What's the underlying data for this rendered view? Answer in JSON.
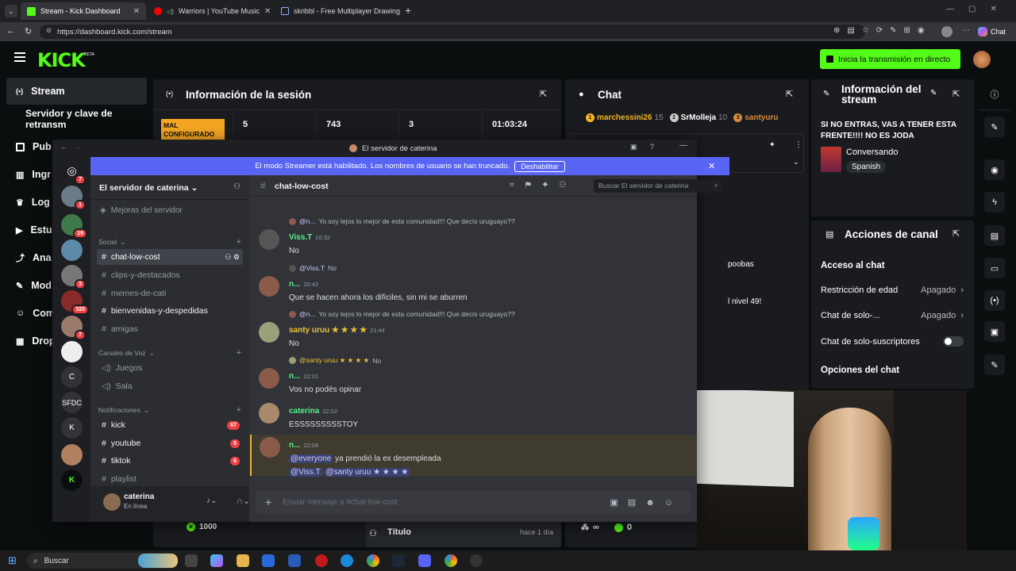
{
  "browser": {
    "tabs": [
      {
        "label": "Stream - Kick Dashboard",
        "active": true
      },
      {
        "label": "Warriors | YouTube Music",
        "active": false
      },
      {
        "label": "skribbl - Free Multiplayer Drawing",
        "active": false
      }
    ],
    "url": "https://dashboard.kick.com/stream",
    "chat_button": "Chat"
  },
  "kick": {
    "logo": "KICK",
    "beta": "BETA",
    "go_live": "Inicia la transmisión en directo",
    "sidebar": {
      "stream": "Stream",
      "server_key": "Servidor y clave de retransm",
      "items": [
        "Pub",
        "Ingr",
        "Log",
        "Estu",
        "Ana",
        "Mod",
        "Com",
        "Drop"
      ]
    },
    "session": {
      "title": "Información de la sesión",
      "status": "MAL CONFIGURADO",
      "stats": [
        "5",
        "743",
        "3",
        "01:03:24"
      ],
      "followers": "1000",
      "footer_title": "Título",
      "footer_time": "hace 1 día"
    },
    "chat": {
      "title": "Chat",
      "leaders": [
        {
          "rank": "1",
          "name": "marchessini26",
          "count": "15"
        },
        {
          "rank": "2",
          "name": "SrMolleja",
          "count": "10"
        },
        {
          "rank": "3",
          "name": "santyuru",
          "count": ""
        }
      ],
      "snippets": [
        "poobas",
        "l nivel 49!"
      ],
      "footer_count": "0",
      "footer_infinity": "∞"
    },
    "stream_info": {
      "title": "Información del stream",
      "text": "SI NO ENTRAS, VAS A TENER ESTA FRENTE!!!! NO ES JODA",
      "category": "Conversando",
      "language": "Spanish"
    },
    "channel_actions": {
      "title": "Acciones de canal",
      "access": "Acceso al chat",
      "rows": [
        {
          "label": "Restricción de edad",
          "value": "Apagado"
        },
        {
          "label": "Chat de solo-...",
          "value": "Apagado"
        },
        {
          "label": "Chat de solo-suscriptores",
          "value": ""
        }
      ],
      "options": "Opciones del chat"
    }
  },
  "discord": {
    "window_title": "El servidor de caterina",
    "streamer_notice": "El modo Streamer está habilitado. Los nombres de usuario se han truncado.",
    "disable_button": "Deshabilitar",
    "server_name": "El servidor de caterina",
    "boost": "Mejoras del servidor",
    "categories": {
      "social": "Social",
      "voice": "Canales de Voz",
      "notif": "Notificaciones"
    },
    "channels_social": [
      "chat-low-cost",
      "clips-y-destacados",
      "memes-de-cati",
      "bienvenidas-y-despedidas",
      "amigas"
    ],
    "channels_voice": [
      "Juegos",
      "Sala"
    ],
    "channels_notif": [
      {
        "name": "kick",
        "badge": "67"
      },
      {
        "name": "youtube",
        "badge": "5"
      },
      {
        "name": "tiktok",
        "badge": "6"
      },
      {
        "name": "playlist",
        "badge": ""
      }
    ],
    "server_badges": [
      "7",
      "1",
      "19",
      "",
      "3",
      "320",
      "7"
    ],
    "server_texts": [
      "C",
      "SFDC",
      "K"
    ],
    "user": {
      "name": "caterina",
      "status": "En línea"
    },
    "channel_header": "chat-low-cost",
    "search_placeholder": "Buscar El servidor de caterina",
    "composer_placeholder": "Enviar mensaje a #chat-low-cost",
    "messages": [
      {
        "reply_user": "@n...",
        "reply_text": "Yo soy lejos lo mejor de esta comunidad!!! Que decís uruguayo??",
        "name": "Viss.T",
        "time": "20:32",
        "text": "No"
      },
      {
        "reply_user": "@Viss.T",
        "reply_text": "No",
        "name": "n...",
        "time": "20:42",
        "text": "Que se hacen ahora los difíciles, sin mi se aburren"
      },
      {
        "reply_user": "@n...",
        "reply_text": "Yo soy lejos lo mejor de esta comunidad!!! Que decís uruguayo??",
        "name": "santy uruu ★ ★ ★ ★",
        "time": "21:44",
        "text": "No"
      },
      {
        "reply_user": "@santy uruu ★ ★ ★ ★",
        "reply_text": "No",
        "name": "n...",
        "time": "22:01",
        "text": "Vos no podés opinar"
      },
      {
        "reply_user": "",
        "reply_text": "",
        "name": "caterina",
        "time": "22:02",
        "text": "ESSSSSSSSSTOY"
      },
      {
        "reply_user": "",
        "reply_text": "",
        "name": "n...",
        "time": "22:04",
        "text": "ya prendió la ex desempleada",
        "mention": "@everyone",
        "mention2": "@Viss.T",
        "mention3": "@santy uruu ★ ★ ★ ★"
      }
    ]
  },
  "taskbar": {
    "search": "Buscar"
  },
  "colors": {
    "kick_green": "#53fc18",
    "discord_blurple": "#5865f2",
    "panel": "#191b1f"
  }
}
